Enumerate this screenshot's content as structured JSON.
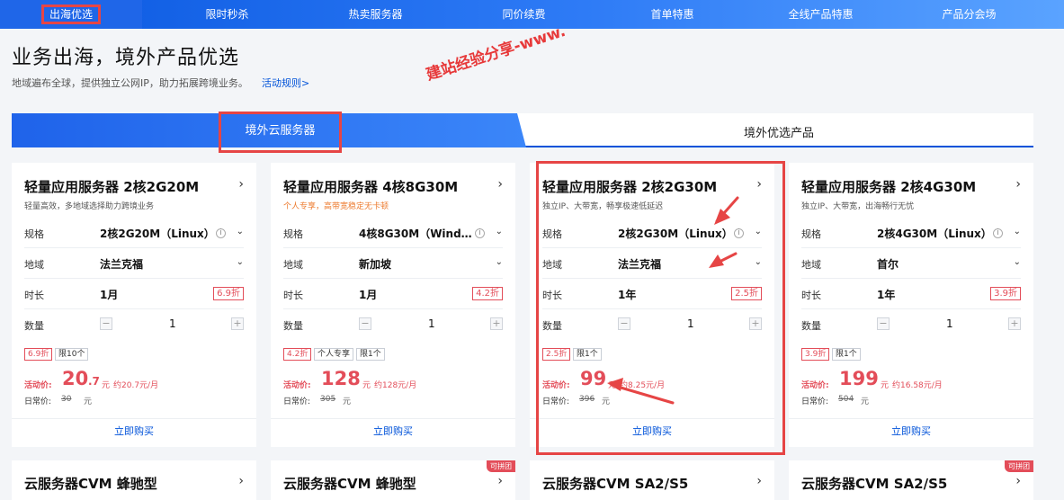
{
  "nav": {
    "items": [
      "出海优选",
      "限时秒杀",
      "热卖服务器",
      "同价续费",
      "首单特惠",
      "全线产品特惠",
      "产品分会场"
    ]
  },
  "page": {
    "title": "业务出海，境外产品优选",
    "subtitle": "地域遍布全球，提供独立公网IP，助力拓展跨境业务。",
    "rules_link": "活动规则>"
  },
  "watermark": "建站经验分享-www.",
  "tabs": {
    "active": "境外云服务器",
    "inactive": "境外优选产品"
  },
  "labels": {
    "spec": "规格",
    "region": "地域",
    "duration": "时长",
    "quantity": "数量",
    "promo": "活动价:",
    "normal": "日常价:",
    "buy": "立即购买",
    "yuan": "元"
  },
  "cards": [
    {
      "title": "轻量应用服务器 2核2G20M",
      "desc": "轻量高效，多地域选择助力跨境业务",
      "spec": "2核2G20M（Linux）",
      "region": "法兰克福",
      "duration": "1月",
      "discount": "6.9折",
      "qty": "1",
      "tags": [
        "6.9折",
        "限10个"
      ],
      "price_int": "20",
      "price_dec": ".7",
      "monthly": "约20.7元/月",
      "normal_price": "30"
    },
    {
      "title": "轻量应用服务器 4核8G30M",
      "desc": "个人专享，高带宽稳定无卡顿",
      "spec": "4核8G30M（Wind…",
      "region": "新加坡",
      "duration": "1月",
      "discount": "4.2折",
      "qty": "1",
      "tags": [
        "4.2折",
        "个人专享",
        "限1个"
      ],
      "price_int": "128",
      "price_dec": "",
      "monthly": "约128元/月",
      "normal_price": "305"
    },
    {
      "title": "轻量应用服务器 2核2G30M",
      "desc": "独立IP、大带宽，畅享极速低延迟",
      "spec": "2核2G30M（Linux）",
      "region": "法兰克福",
      "duration": "1年",
      "discount": "2.5折",
      "qty": "1",
      "tags": [
        "2.5折",
        "限1个"
      ],
      "price_int": "99",
      "price_dec": "",
      "monthly": "约8.25元/月",
      "normal_price": "396"
    },
    {
      "title": "轻量应用服务器 2核4G30M",
      "desc": "独立IP、大带宽，出海畅行无忧",
      "spec": "2核4G30M（Linux）",
      "region": "首尔",
      "duration": "1年",
      "discount": "3.9折",
      "qty": "1",
      "tags": [
        "3.9折",
        "限1个"
      ],
      "price_int": "199",
      "price_dec": "",
      "monthly": "约16.58元/月",
      "normal_price": "504"
    }
  ],
  "cards_row2": [
    {
      "title": "云服务器CVM 蜂驰型",
      "badge": ""
    },
    {
      "title": "云服务器CVM 蜂驰型",
      "badge": "可拼团"
    },
    {
      "title": "云服务器CVM SA2/S5",
      "badge": ""
    },
    {
      "title": "云服务器CVM SA2/S5",
      "badge": "可拼团"
    }
  ],
  "colors": {
    "brand": "#0052d9",
    "price_red": "#e34d59",
    "annotation_red": "#e64545"
  }
}
